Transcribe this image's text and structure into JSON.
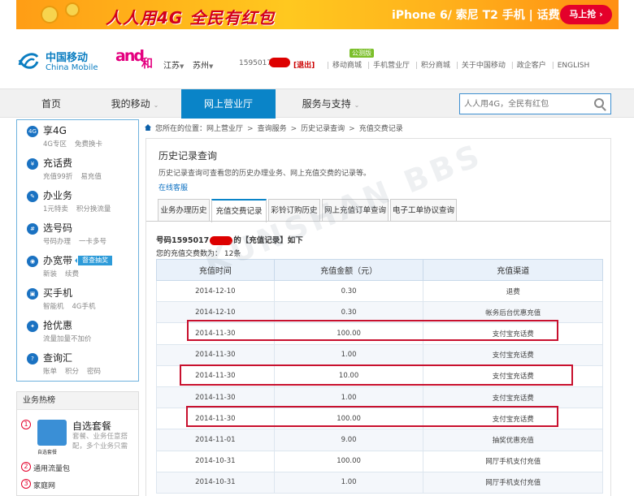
{
  "banner": {
    "slogan": "人人用4G 全民有红包",
    "promo": "iPhone 6/ 索尼 T2 手机 | 话费 | 流量",
    "cta": "马上抢 ›"
  },
  "header": {
    "brand_cn": "中国移动",
    "brand_en": "China Mobile",
    "and_logo": "and",
    "and_he": "和",
    "province": "江苏",
    "city": "苏州",
    "phone_partial": "1595017",
    "logout": "[退出]",
    "beta_badge": "公测版",
    "links": [
      "移动商城",
      "手机营业厅",
      "积分商城",
      "关于中国移动",
      "政企客户",
      "ENGLISH"
    ]
  },
  "nav": {
    "items": [
      {
        "label": "首页"
      },
      {
        "label": "我的移动",
        "caret": "⌄"
      },
      {
        "label": "网上营业厅"
      },
      {
        "label": "服务与支持",
        "caret": "⌄"
      }
    ],
    "search_placeholder": "人人用4G，全民有红包"
  },
  "sidebar": {
    "items": [
      {
        "icon_text": "4G",
        "title": "享4G",
        "subs": [
          "4G专区",
          "免费换卡"
        ]
      },
      {
        "icon_text": "¥",
        "title": "充话费",
        "subs": [
          "充值99折",
          "易充值"
        ]
      },
      {
        "icon_text": "✎",
        "title": "办业务",
        "subs": [
          "1元特卖",
          "积分换流量"
        ]
      },
      {
        "icon_text": "#",
        "title": "选号码",
        "subs": [
          "号码办理",
          "一卡多号"
        ]
      },
      {
        "icon_text": "◉",
        "title": "办宽带",
        "tag": "督查抽奖",
        "subs": [
          "新装",
          "续费"
        ]
      },
      {
        "icon_text": "▣",
        "title": "买手机",
        "subs": [
          "智能机",
          "4G手机"
        ]
      },
      {
        "icon_text": "✦",
        "title": "抢优惠",
        "subs": [
          "流量加量不加价"
        ]
      },
      {
        "icon_text": "?",
        "title": "查询汇",
        "subs": [
          "账单",
          "积分",
          "密码"
        ]
      }
    ]
  },
  "hot": {
    "title": "业务热榜",
    "featured": {
      "num": "1",
      "name": "自选套餐",
      "desc": "套餐、业务任意搭配，多个业务只需",
      "img_caption": "自选套餐"
    },
    "items": [
      {
        "num": "2",
        "label": "通用流量包"
      },
      {
        "num": "3",
        "label": "家庭网"
      }
    ]
  },
  "breadcrumb": {
    "prefix": "您所在的位置：",
    "trail": [
      "网上营业厅",
      "查询服务",
      "历史记录查询",
      "充值交费记录"
    ]
  },
  "panel": {
    "title": "历史记录查询",
    "desc": "历史记录查询可查看您的历史办理业务、网上充值交费的记录等。",
    "help_link": "在线客服",
    "tabs": [
      "业务办理历史",
      "充值交费记录",
      "彩铃订购历史",
      "网上充值订单查询",
      "电子工单协议查询"
    ],
    "active_tab": 1,
    "record_head_prefix": "号码1595017",
    "record_head_suffix": "的【充值记录】如下",
    "record_count_label": "您的充值交费数为：",
    "record_count": "12条",
    "columns": [
      "充值时间",
      "充值金额（元）",
      "充值渠道"
    ],
    "rows": [
      [
        "2014-12-10",
        "0.30",
        "退费"
      ],
      [
        "2014-12-10",
        "0.30",
        "帐务后台优惠充值"
      ],
      [
        "2014-11-30",
        "100.00",
        "支付宝充话费"
      ],
      [
        "2014-11-30",
        "1.00",
        "支付宝充话费"
      ],
      [
        "2014-11-30",
        "10.00",
        "支付宝充话费"
      ],
      [
        "2014-11-30",
        "1.00",
        "支付宝充话费"
      ],
      [
        "2014-11-30",
        "100.00",
        "支付宝充话费"
      ],
      [
        "2014-11-01",
        "9.00",
        "抽奖优惠充值"
      ],
      [
        "2014-10-31",
        "100.00",
        "网厅手机支付充值"
      ],
      [
        "2014-10-31",
        "1.00",
        "网厅手机支付充值"
      ]
    ],
    "highlighted_rows": [
      2,
      4,
      6
    ]
  },
  "watermark": "KUNSHAN BBS"
}
